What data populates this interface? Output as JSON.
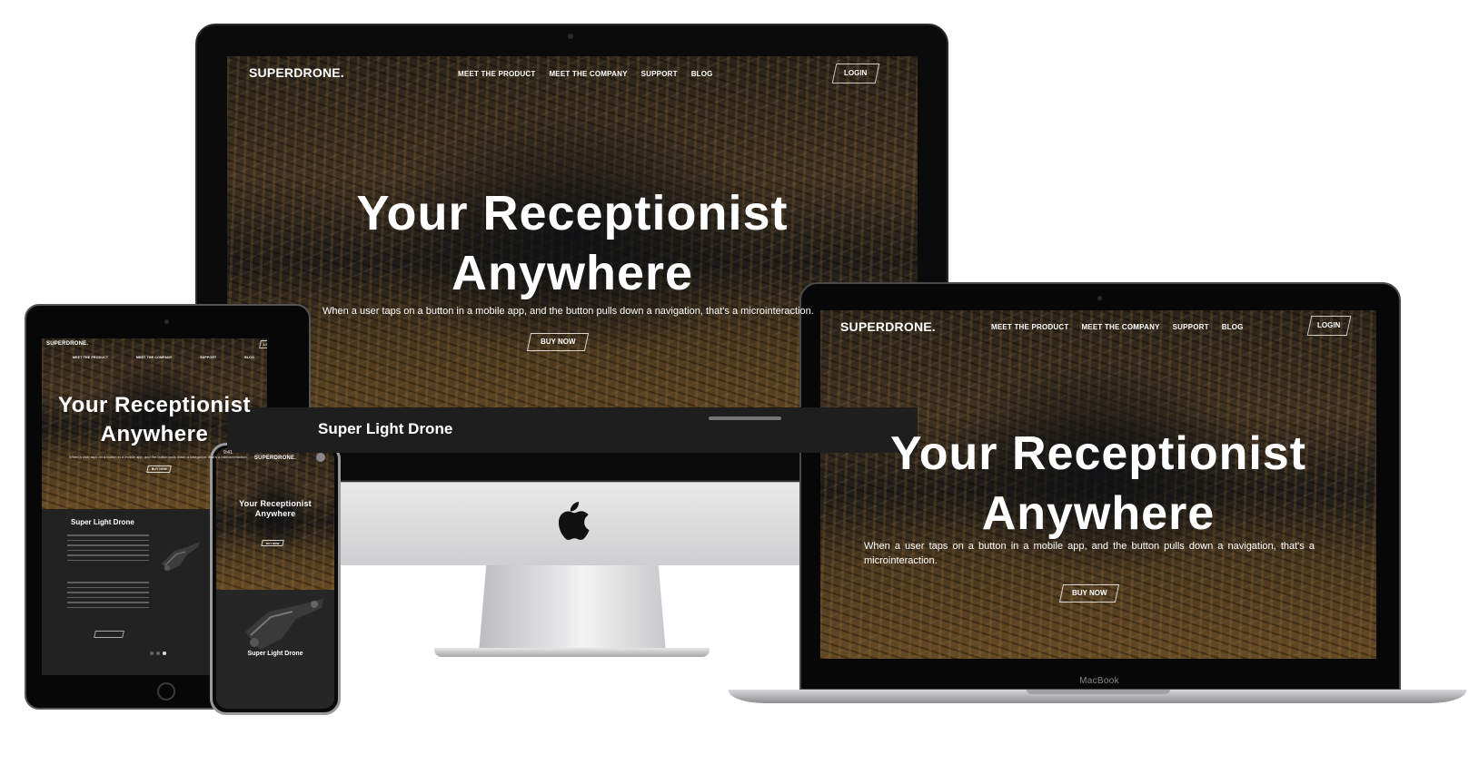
{
  "site": {
    "logo": "SUPERDRONE.",
    "nav": [
      "MEET THE PRODUCT",
      "MEET THE COMPANY",
      "SUPPORT",
      "BLOG"
    ],
    "login": "LOGIN",
    "hero_title_line1": "Your Receptionist",
    "hero_title_line2": "Anywhere",
    "hero_subtitle": "When a user taps on a button in a mobile app, and the button pulls down a navigation, that's a microinteraction.",
    "hero_subtitle_imac": "When a user taps on a button in a mobile app, and the button pulls down a navigation, that's a microinteraction.",
    "buy_button": "BUY NOW",
    "section_title": "Super Light Drone",
    "section_title_imac": "Super Light Drone"
  },
  "devices": {
    "macbook_label": "MacBook",
    "iphone_time": "9:41"
  },
  "colors": {
    "bezel": "#0b0b0b",
    "section_bg": "#222222",
    "text": "#ffffff"
  }
}
